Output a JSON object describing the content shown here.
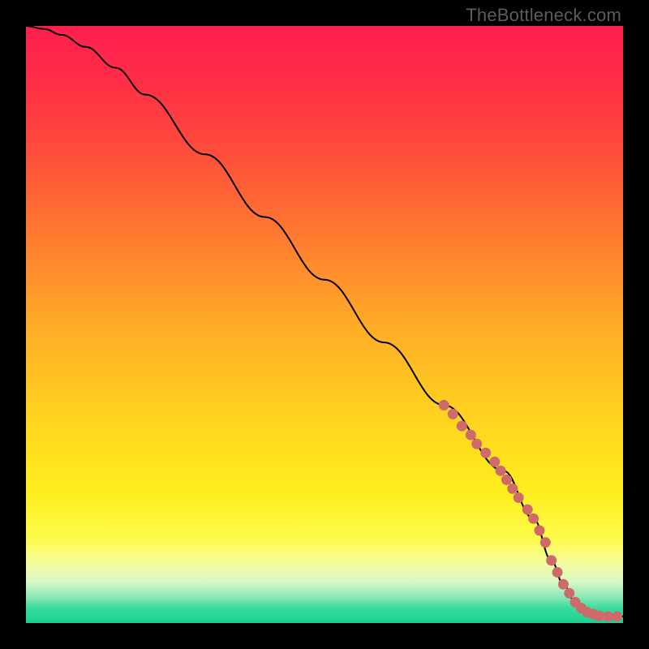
{
  "watermark": "TheBottleneck.com",
  "chart_data": {
    "type": "line",
    "title": "",
    "xlabel": "",
    "ylabel": "",
    "xlim": [
      0,
      100
    ],
    "ylim": [
      0,
      100
    ],
    "grid": false,
    "legend": false,
    "curve": {
      "name": "bottleneck-curve",
      "x": [
        0,
        3,
        6,
        10,
        15,
        20,
        30,
        40,
        50,
        60,
        70,
        80,
        85,
        88,
        90,
        92,
        94,
        96,
        98,
        100
      ],
      "y": [
        100,
        99.5,
        98.5,
        96.5,
        93,
        88.5,
        78.5,
        68,
        57.5,
        47,
        36.5,
        25.5,
        17.5,
        10.5,
        6.5,
        3.5,
        1.8,
        1.2,
        1.1,
        1.1
      ]
    },
    "highlight_points": {
      "name": "highlight-segment",
      "color": "#cf6a6a",
      "x": [
        70,
        71.5,
        73,
        74.5,
        75.5,
        77,
        78.5,
        79.5,
        80.5,
        81.5,
        82.5,
        84,
        85,
        86,
        87,
        88,
        89,
        90,
        91,
        92,
        93,
        94,
        95,
        96,
        97.5,
        99
      ],
      "y": [
        36.5,
        35,
        33,
        31.5,
        30,
        28.5,
        27,
        25.5,
        24,
        22.5,
        21,
        19,
        17.5,
        15.5,
        13.5,
        10.5,
        8.5,
        6.5,
        5,
        3.5,
        2.5,
        1.8,
        1.5,
        1.2,
        1.1,
        1.1
      ]
    },
    "background_gradient": {
      "stops": [
        {
          "offset": 0.0,
          "color": "#ff1f4f"
        },
        {
          "offset": 0.08,
          "color": "#ff2b48"
        },
        {
          "offset": 0.2,
          "color": "#ff4a3c"
        },
        {
          "offset": 0.35,
          "color": "#ff7a30"
        },
        {
          "offset": 0.5,
          "color": "#ffab27"
        },
        {
          "offset": 0.65,
          "color": "#ffd21f"
        },
        {
          "offset": 0.78,
          "color": "#ffee1e"
        },
        {
          "offset": 0.86,
          "color": "#fdfc4a"
        },
        {
          "offset": 0.9,
          "color": "#f6fca0"
        },
        {
          "offset": 0.93,
          "color": "#d9f8c4"
        },
        {
          "offset": 0.955,
          "color": "#8fe9b8"
        },
        {
          "offset": 0.975,
          "color": "#3bdc9d"
        },
        {
          "offset": 1.0,
          "color": "#17d08f"
        }
      ]
    }
  }
}
